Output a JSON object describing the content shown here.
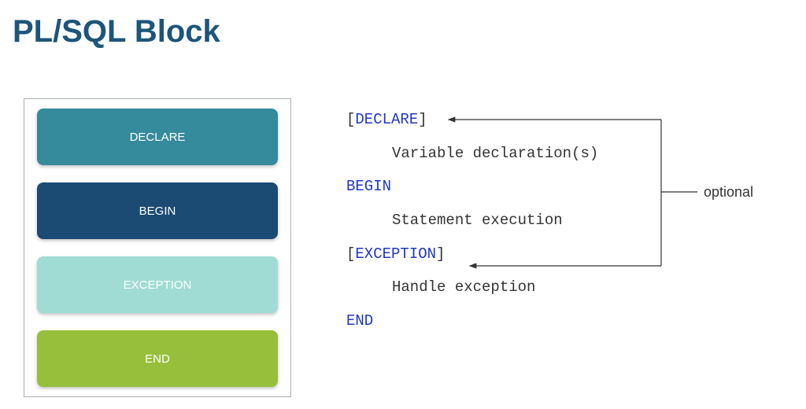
{
  "title": "PL/SQL Block",
  "bars": {
    "declare": "DECLARE",
    "begin": "BEGIN",
    "exception": "EXCEPTION",
    "end": "END"
  },
  "code": {
    "declare_kw": "DECLARE",
    "declare_desc": "Variable declaration(s)",
    "begin_kw": "BEGIN",
    "begin_desc": "Statement execution",
    "exception_kw": "EXCEPTION",
    "exception_desc": "Handle exception",
    "end_kw": "END"
  },
  "annotations": {
    "optional_label": "optional"
  }
}
